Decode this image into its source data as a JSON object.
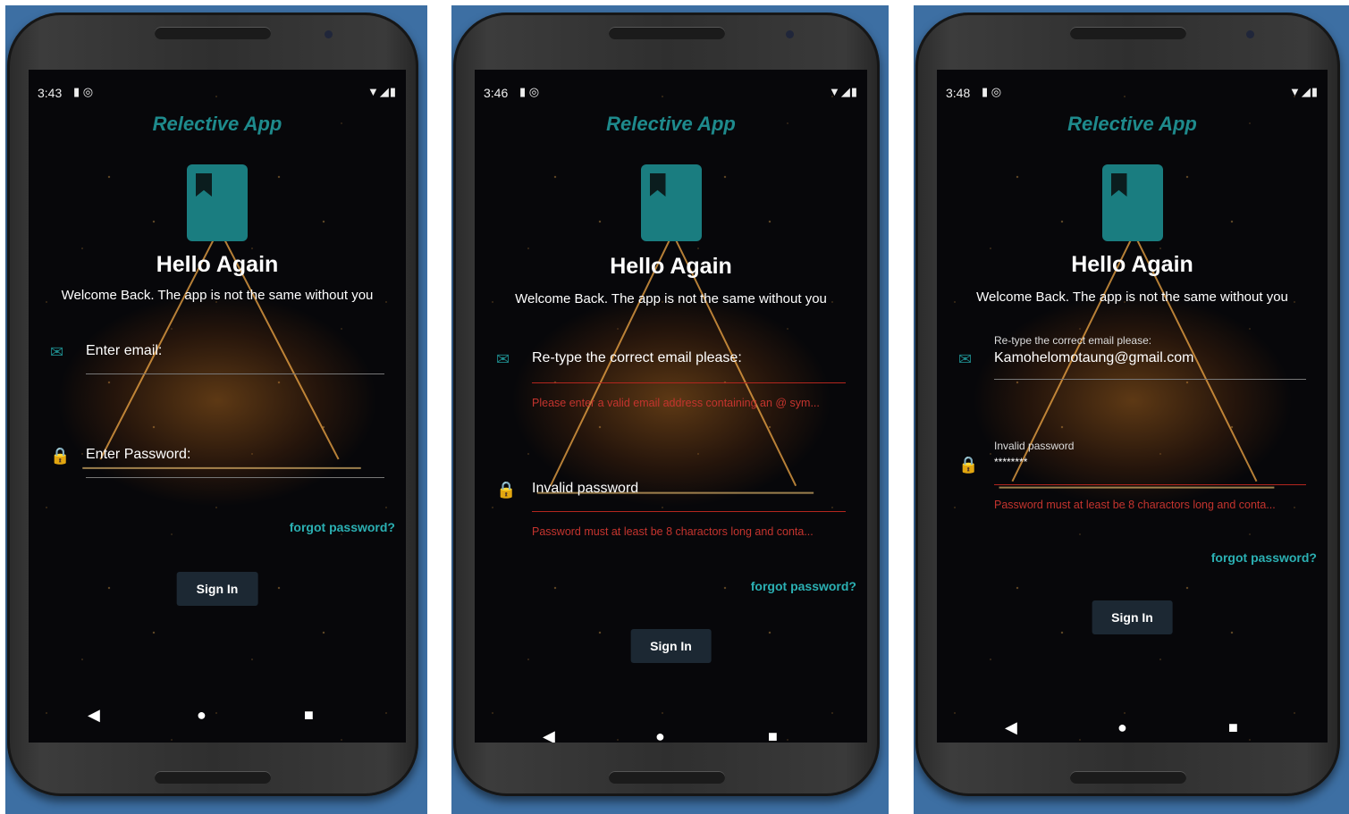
{
  "app": {
    "title": "Relective App",
    "accent": "#1e8a8c",
    "link_color": "#2bb0b3",
    "error_color": "#c4342e"
  },
  "screens": [
    {
      "status": {
        "time": "3:43"
      },
      "heading": "Hello Again",
      "subheading": "Welcome Back. The app is not the same without you",
      "email": {
        "placeholder": "Enter email:"
      },
      "password": {
        "placeholder": "Enter Password:"
      },
      "forgot": "forgot password?",
      "signin": "Sign In"
    },
    {
      "status": {
        "time": "3:46"
      },
      "heading": "Hello Again",
      "subheading": "Welcome Back. The app is not the same without you",
      "email": {
        "placeholder": "Re-type the correct email please:",
        "error": "Please enter a valid email address containing an @ sym..."
      },
      "password": {
        "placeholder": "Invalid password",
        "error": "Password must at least be 8 charactors long and conta..."
      },
      "forgot": "forgot password?",
      "signin": "Sign In"
    },
    {
      "status": {
        "time": "3:48"
      },
      "heading": "Hello Again",
      "subheading": "Welcome Back. The app is not the same without you",
      "email": {
        "label": "Re-type the correct email please:",
        "value": "Kamohelomotaung@gmail.com"
      },
      "password": {
        "label": "Invalid password",
        "value": "********",
        "error": "Password must at least be 8 charactors long and conta..."
      },
      "forgot": "forgot password?",
      "signin": "Sign In"
    }
  ]
}
